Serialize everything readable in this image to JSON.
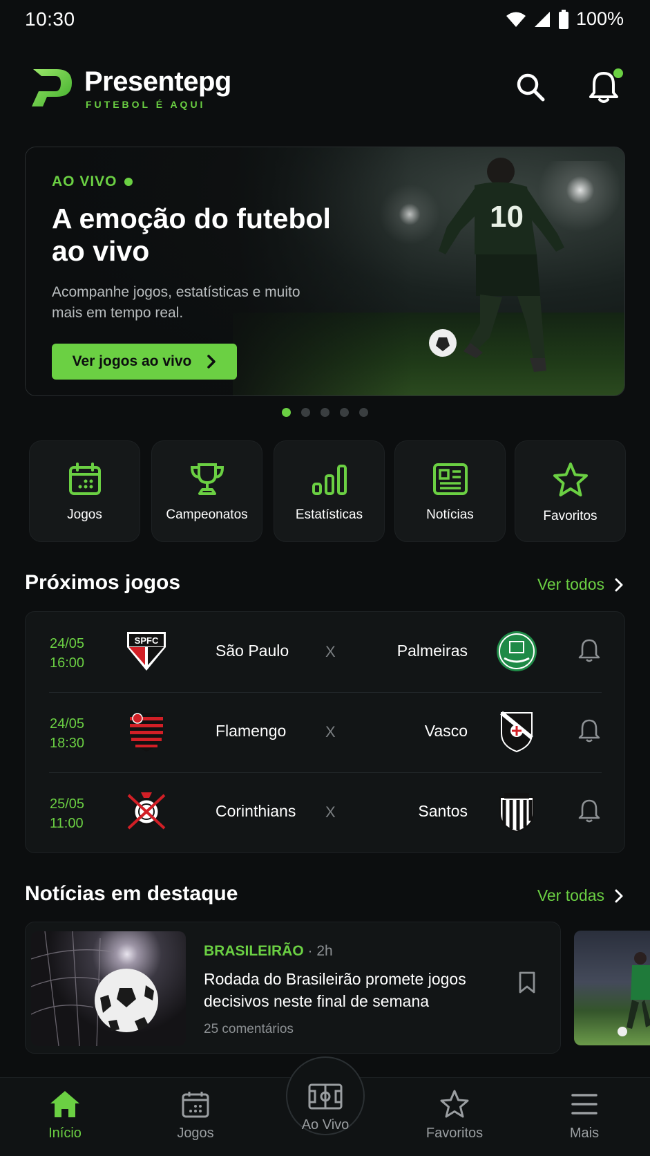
{
  "status": {
    "time": "10:30",
    "battery": "100%"
  },
  "header": {
    "brand": "Presentepg",
    "tagline": "FUTEBOL É AQUI"
  },
  "hero": {
    "live_label": "AO VIVO",
    "title": "A emoção do futebol ao vivo",
    "subtitle": "Acompanhe jogos, estatísticas e muito mais em tempo real.",
    "cta": "Ver jogos ao vivo",
    "jersey_number": "10",
    "pages": 5,
    "active_page": 1
  },
  "categories": [
    {
      "label": "Jogos",
      "icon": "calendar-icon"
    },
    {
      "label": "Campeonatos",
      "icon": "trophy-icon"
    },
    {
      "label": "Estatísticas",
      "icon": "bar-chart-icon"
    },
    {
      "label": "Notícias",
      "icon": "newspaper-icon"
    },
    {
      "label": "Favoritos",
      "icon": "star-icon"
    }
  ],
  "upcoming": {
    "title": "Próximos jogos",
    "link": "Ver todos",
    "matches": [
      {
        "date": "24/05",
        "time": "16:00",
        "home": "São Paulo",
        "away": "Palmeiras",
        "vs": "X",
        "home_crest_text": "SPFC"
      },
      {
        "date": "24/05",
        "time": "18:30",
        "home": "Flamengo",
        "away": "Vasco",
        "vs": "X"
      },
      {
        "date": "25/05",
        "time": "11:00",
        "home": "Corinthians",
        "away": "Santos",
        "vs": "X"
      }
    ]
  },
  "news": {
    "title": "Notícias em destaque",
    "link": "Ver todas",
    "items": [
      {
        "category": "BRASILEIRÃO",
        "age": "· 2h",
        "headline": "Rodada do Brasileirão promete jogos decisivos neste final de semana",
        "comments": "25 comentários"
      }
    ]
  },
  "nav": [
    {
      "label": "Início",
      "icon": "home-icon",
      "active": true
    },
    {
      "label": "Jogos",
      "icon": "calendar-icon"
    },
    {
      "label": "Ao Vivo",
      "icon": "pitch-icon"
    },
    {
      "label": "Favoritos",
      "icon": "star-icon"
    },
    {
      "label": "Mais",
      "icon": "menu-icon"
    }
  ],
  "colors": {
    "accent": "#6bd043",
    "background": "#0c0e0f",
    "card": "#121516"
  }
}
